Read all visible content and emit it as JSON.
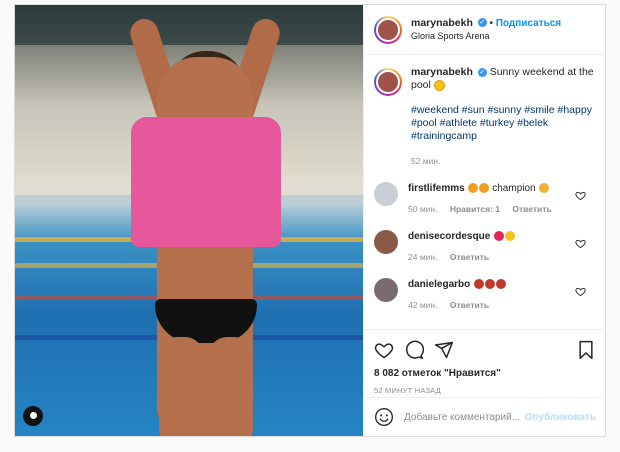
{
  "post": {
    "author": "marynabekh",
    "follow_label": "Подписаться",
    "separator": "•",
    "location": "Gloria Sports Arena"
  },
  "caption": {
    "author": "marynabekh",
    "text": "Sunny weekend at the pool",
    "hashtags": "#weekend #sun #sunny #smile #happy #pool #athlete #turkey #belek #trainingcamp",
    "time": "52 мин."
  },
  "comments": [
    {
      "author": "firstlifemms",
      "text": "champion",
      "time": "50 мин.",
      "likes": "Нравится: 1",
      "reply": "Ответить",
      "avatar_color": "#c9cfd6",
      "emoji_colors": [
        "#f0a020",
        "#f0a020"
      ],
      "trailing_emoji_color": "#f0b030"
    },
    {
      "author": "denisecordesque",
      "text": "",
      "time": "24 мин.",
      "reply": "Ответить",
      "avatar_color": "#8a5a48",
      "emoji_colors": [
        "#e0245e",
        "#f7c21a"
      ]
    },
    {
      "author": "danielegarbo",
      "text": "",
      "time": "42 мин.",
      "reply": "Ответить",
      "avatar_color": "#7a6a72",
      "emoji_colors": [
        "#c0392b",
        "#c0392b",
        "#c0392b"
      ]
    }
  ],
  "actions": {
    "likes_text": "8 082 отметок \"Нравится\"",
    "posted_ago": "52 МИНУТ НАЗАД"
  },
  "add_comment": {
    "placeholder": "Добавьте комментарий...",
    "publish_label": "Опубликовать"
  },
  "colors": {
    "link_blue": "#0095f6",
    "publish_disabled": "#b2dffc",
    "hashtag": "#00376b",
    "muted": "#8e8e8e",
    "verified": "#3897f0"
  },
  "icons": [
    "user-tag-icon",
    "verified-icon",
    "sun-emoji-icon",
    "heart-icon",
    "comment-icon",
    "share-icon",
    "bookmark-icon",
    "smile-icon"
  ]
}
